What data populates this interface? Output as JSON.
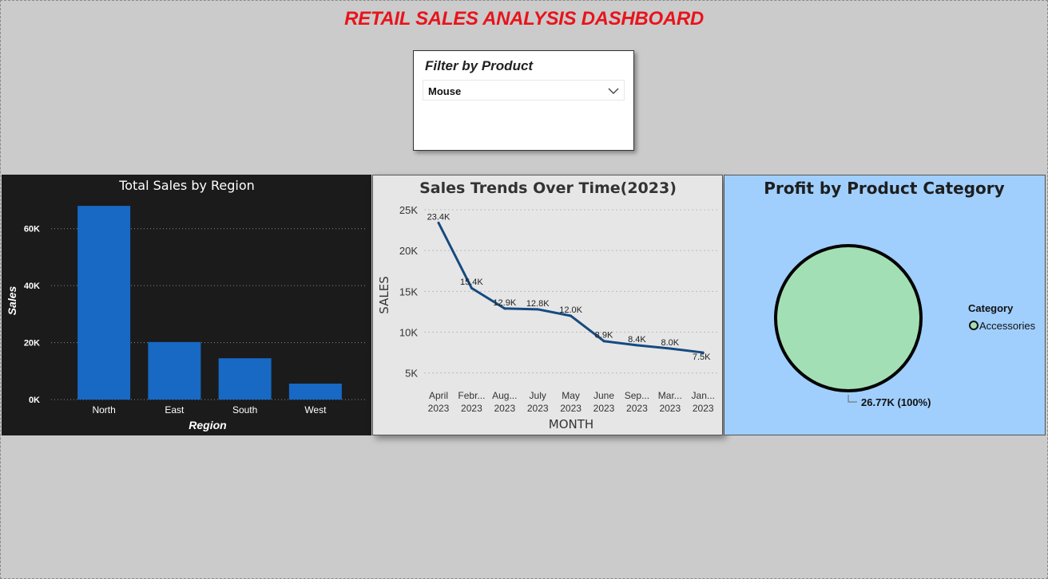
{
  "dashboard": {
    "title": "RETAIL SALES ANALYSIS DASHBOARD"
  },
  "slicer": {
    "title": "Filter by Product",
    "selected": "Mouse"
  },
  "chart_data": [
    {
      "type": "bar",
      "title": "Total Sales by Region",
      "xlabel": "Region",
      "ylabel": "Sales",
      "categories": [
        "North",
        "East",
        "South",
        "West"
      ],
      "values": [
        68000,
        20200,
        14500,
        5600
      ],
      "ylim": [
        0,
        70000
      ],
      "yticks": [
        0,
        20000,
        40000,
        60000
      ],
      "ytick_labels": [
        "0K",
        "20K",
        "40K",
        "60K"
      ],
      "grid": true,
      "colors": {
        "bar": "#1769c4",
        "background": "#1b1b1b",
        "text": "#ffffff"
      }
    },
    {
      "type": "line",
      "title": "Sales Trends Over Time(2023)",
      "xlabel": "MONTH",
      "ylabel": "SALES",
      "categories": [
        [
          "April",
          "2023"
        ],
        [
          "Febr...",
          "2023"
        ],
        [
          "Aug...",
          "2023"
        ],
        [
          "July",
          "2023"
        ],
        [
          "May",
          "2023"
        ],
        [
          "June",
          "2023"
        ],
        [
          "Sep...",
          "2023"
        ],
        [
          "Mar...",
          "2023"
        ],
        [
          "Jan...",
          "2023"
        ]
      ],
      "values": [
        23400,
        15400,
        12900,
        12800,
        12000,
        8900,
        8400,
        8000,
        7500
      ],
      "data_labels": [
        "23.4K",
        "15.4K",
        "12.9K",
        "12.8K",
        "12.0K",
        "8.9K",
        "8.4K",
        "8.0K",
        "7.5K"
      ],
      "ylim": [
        3500,
        25000
      ],
      "yticks": [
        5000,
        10000,
        15000,
        20000,
        25000
      ],
      "ytick_labels": [
        "5K",
        "10K",
        "15K",
        "20K",
        "25K"
      ],
      "grid": true,
      "colors": {
        "line": "#154a80",
        "background": "#e6e6e6",
        "text": "#333333"
      }
    },
    {
      "type": "pie",
      "title": "Profit by Product Category",
      "legend_title": "Category",
      "legend_position": "right",
      "slices": [
        {
          "label": "Accessories",
          "value": 26770,
          "percent": 100,
          "data_label": "26.77K (100%)",
          "color": "#a3dfb5"
        }
      ],
      "colors": {
        "background": "#a0cffd",
        "outline": "#000000"
      }
    }
  ]
}
